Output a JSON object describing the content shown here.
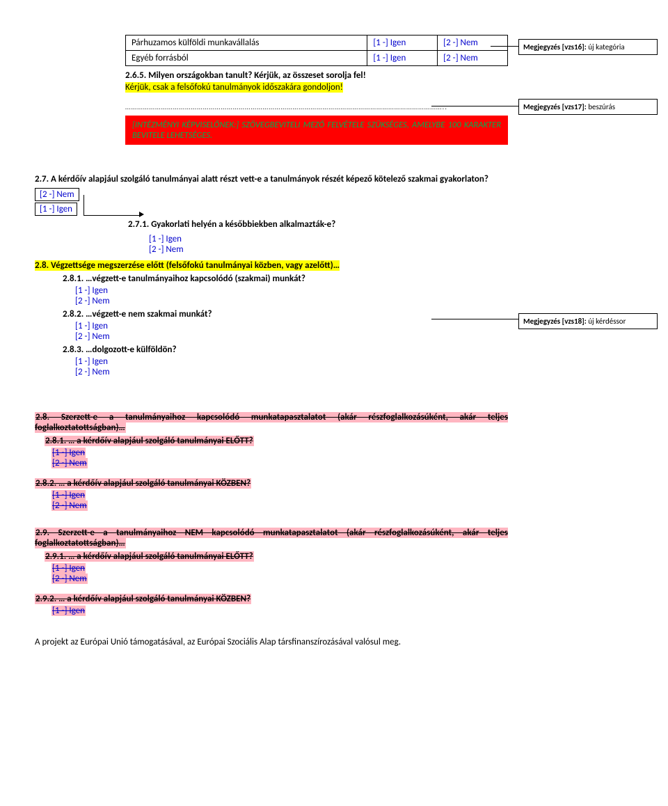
{
  "table_top": {
    "rows": [
      {
        "label": "Párhuzamos külföldi munkavállalás",
        "c1": "[1 -] Igen",
        "c2": "[2 -] Nem"
      },
      {
        "label": "Egyéb forrásból",
        "c1": "[1 -] Igen",
        "c2": "[2 -] Nem"
      }
    ]
  },
  "q265": "2.6.5. Milyen országokban tanult? Kérjük, az összeset sorolja fel!",
  "yellow_line": "Kérjük, csak a felsőfokú tanulmányok időszakára gondoljon!",
  "redbox": "[INTÉZMÉNYI KÉPVISELŐNEK:] SZÖVEGBEVITELI MEZŐ FELVÉTELE SZÜKSÉGES, AMELYBE 100 KARAKTER BEVITELE LEHETSÉGES.",
  "q27": "2.7. A kérdőív alapjául szolgáló tanulmányai alatt részt vett-e a tanulmányok részét képező kötelező szakmai gyakorlaton?",
  "opt_nem_boxed": "[2 -] Nem",
  "opt_igen_boxed": "[1 -] Igen",
  "q271": "2.7.1. Gyakorlati helyén a későbbiekben alkalmazták-e?",
  "igen": "[1 -] Igen",
  "nem": "[2 -] Nem",
  "q28": "2.8. Végzettsége megszerzése előtt (felsőfokú tanulmányai közben, vagy azelőtt)…",
  "q281": "2.8.1. …végzett-e tanulmányaihoz kapcsolódó (szakmai) munkát?",
  "q282": "2.8.2. …végzett-e nem szakmai munkát?",
  "q283": "2.8.3. …dolgozott-e külföldön?",
  "del_q28": "2.8. Szerzett-e a tanulmányaihoz kapcsolódó munkatapasztalatot (akár részfoglalkozásúként, akár teljes foglalkoztatottságban)…",
  "del_q281": "2.8.1. … a kérdőív alapjául szolgáló tanulmányai ELŐTT?",
  "del_q282": "2.8.2. … a kérdőív alapjául szolgáló tanulmányai KÖZBEN?",
  "del_q29": "2.9. Szerzett-e a tanulmányaihoz NEM kapcsolódó munkatapasztalatot (akár részfoglalkozásúként, akár teljes foglalkoztatottságban)…",
  "del_q291": "2.9.1. … a kérdőív alapjául szolgáló tanulmányai ELŐTT?",
  "del_q292": "2.9.2. … a kérdőív alapjául szolgáló tanulmányai KÖZBEN?",
  "comments": {
    "c16": {
      "label": "Megjegyzés [vzs16]:",
      "text": " új kategória"
    },
    "c17": {
      "label": "Megjegyzés [vzs17]:",
      "text": " beszúrás"
    },
    "c18": {
      "label": "Megjegyzés [vzs18]:",
      "text": " új kérdéssor"
    }
  },
  "footer": "A projekt az Európai Unió támogatásával, az Európai Szociális Alap társfinanszírozásával valósul meg."
}
